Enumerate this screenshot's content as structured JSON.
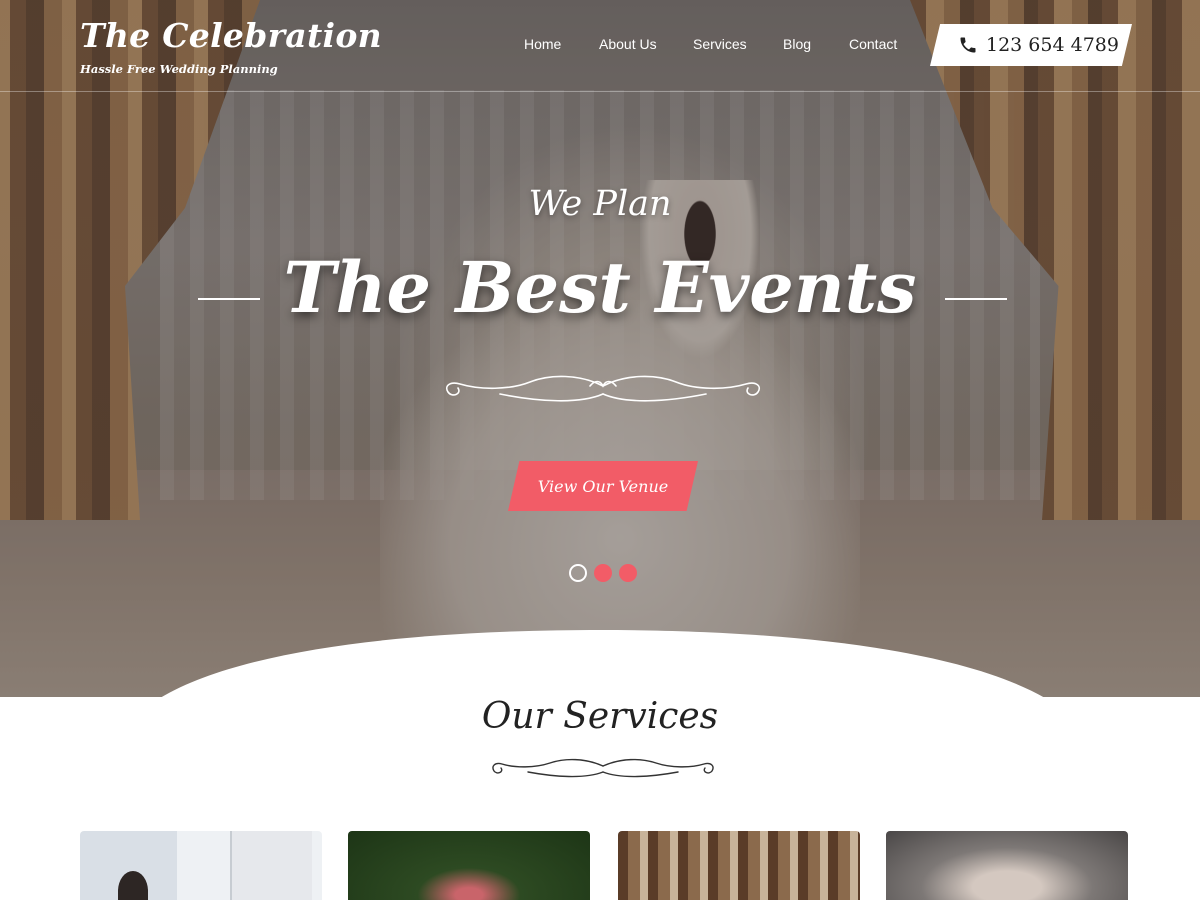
{
  "header": {
    "brand_title": "The Celebration",
    "brand_tagline": "Hassle Free Wedding Planning",
    "nav": [
      {
        "label": "Home"
      },
      {
        "label": "About Us"
      },
      {
        "label": "Services"
      },
      {
        "label": "Blog"
      },
      {
        "label": "Contact"
      }
    ],
    "phone": {
      "icon": "phone-icon",
      "number": "123 654 4789"
    }
  },
  "hero": {
    "subtitle": "We Plan",
    "title": "The Best Events",
    "cta_label": "View Our Venue",
    "slider": {
      "total_slides": 3,
      "active_index": 0
    }
  },
  "services": {
    "title": "Our Services",
    "cards": [
      {
        "image": "couple-with-bride-photo"
      },
      {
        "image": "garden-bouquet-photo"
      },
      {
        "image": "forest-wedding-couple-photo"
      },
      {
        "image": "bride-with-veil-photo"
      }
    ]
  },
  "colors": {
    "accent": "#f25c67",
    "header_text": "#ffffff",
    "heading_text": "#222222"
  }
}
